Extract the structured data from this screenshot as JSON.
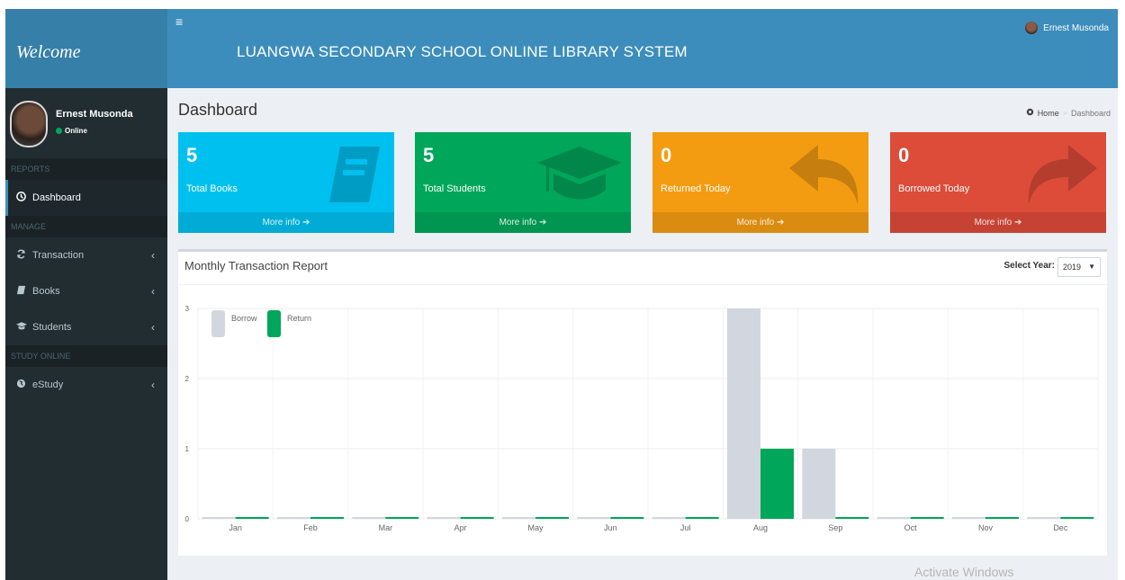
{
  "sidebar": {
    "logo_text": "Welcome",
    "user": {
      "name": "Ernest Musonda",
      "status": "Online"
    },
    "sections": {
      "reports": "REPORTS",
      "manage": "MANAGE",
      "study": "STUDY ONLINE"
    },
    "items": {
      "dashboard": "Dashboard",
      "transaction": "Transaction",
      "books": "Books",
      "students": "Students",
      "estudy": "eStudy"
    },
    "chevron": "‹"
  },
  "header": {
    "toggle_icon": "≡",
    "title": "LUANGWA SECONDARY SCHOOL ONLINE LIBRARY SYSTEM",
    "user_name": "Ernest Musonda"
  },
  "page": {
    "title": "Dashboard",
    "breadcrumb": {
      "home": "Home",
      "separator": ">",
      "current": "Dashboard"
    }
  },
  "stats": [
    {
      "value": "5",
      "label": "Total Books",
      "more": "More info",
      "color": "#00c0ef",
      "icon": "book-icon"
    },
    {
      "value": "5",
      "label": "Total Students",
      "more": "More info",
      "color": "#00a65a",
      "icon": "graduation-cap-icon"
    },
    {
      "value": "0",
      "label": "Returned Today",
      "more": "More info",
      "color": "#f39c12",
      "icon": "reply-icon"
    },
    {
      "value": "0",
      "label": "Borrowed Today",
      "more": "More info",
      "color": "#dd4b39",
      "icon": "share-icon"
    }
  ],
  "report": {
    "title": "Monthly Transaction Report",
    "select_label": "Select Year:",
    "year": "2019",
    "arrow": "▼"
  },
  "chart_data": {
    "type": "bar",
    "categories": [
      "Jan",
      "Feb",
      "Mar",
      "Apr",
      "May",
      "Jun",
      "Jul",
      "Aug",
      "Sep",
      "Oct",
      "Nov",
      "Dec"
    ],
    "series": [
      {
        "name": "Borrow",
        "color": "#d2d6de",
        "values": [
          0,
          0,
          0,
          0,
          0,
          0,
          0,
          3,
          1,
          0,
          0,
          0
        ]
      },
      {
        "name": "Return",
        "color": "#00a65a",
        "values": [
          0,
          0,
          0,
          0,
          0,
          0,
          0,
          1,
          0,
          0,
          0,
          0
        ]
      }
    ],
    "ylim": [
      0,
      3
    ],
    "yticks": [
      0,
      1,
      2,
      3
    ],
    "grid": true,
    "legend": "top-left"
  },
  "watermark": "Activate Windows"
}
